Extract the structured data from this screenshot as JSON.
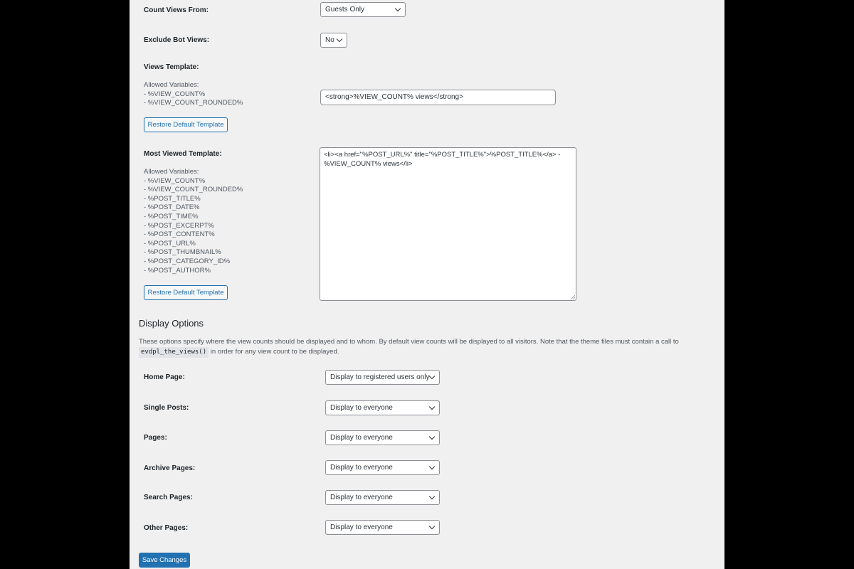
{
  "settings": {
    "count_views_from": {
      "label": "Count Views From:",
      "value": "Guests Only"
    },
    "exclude_bot_views": {
      "label": "Exclude Bot Views:",
      "value": "No"
    },
    "views_template": {
      "label": "Views Template:",
      "allowed_title": "Allowed Variables:",
      "variables": [
        "- %VIEW_COUNT%",
        "- %VIEW_COUNT_ROUNDED%"
      ],
      "value": "<strong>%VIEW_COUNT% views</strong>",
      "restore_label": "Restore Default Template"
    },
    "most_viewed_template": {
      "label": "Most Viewed Template:",
      "allowed_title": "Allowed Variables:",
      "variables": [
        "- %VIEW_COUNT%",
        "- %VIEW_COUNT_ROUNDED%",
        "- %POST_TITLE%",
        "- %POST_DATE%",
        "- %POST_TIME%",
        "- %POST_EXCERPT%",
        "- %POST_CONTENT%",
        "- %POST_URL%",
        "- %POST_THUMBNAIL%",
        "- %POST_CATEGORY_ID%",
        "- %POST_AUTHOR%"
      ],
      "value": "<li><a href=\"%POST_URL%\" title=\"%POST_TITLE%\">%POST_TITLE%</a> - %VIEW_COUNT% views</li>",
      "restore_label": "Restore Default Template"
    }
  },
  "display_options": {
    "heading": "Display Options",
    "description_before": "These options specify where the view counts should be displayed and to whom. By default view counts will be displayed to all visitors. Note that the theme files must contain a call to",
    "code": "evdpl_the_views()",
    "description_after": " in order for any view count to be displayed.",
    "rows": [
      {
        "label": "Home Page:",
        "value": "Display to registered users only"
      },
      {
        "label": "Single Posts:",
        "value": "Display to everyone"
      },
      {
        "label": "Pages:",
        "value": "Display to everyone"
      },
      {
        "label": "Archive Pages:",
        "value": "Display to everyone"
      },
      {
        "label": "Search Pages:",
        "value": "Display to everyone"
      },
      {
        "label": "Other Pages:",
        "value": "Display to everyone"
      }
    ]
  },
  "save_label": "Save Changes",
  "colors": {
    "accent": "#2271b1",
    "panel_bg": "#f0f0f1",
    "outer_bg": "#000000"
  }
}
